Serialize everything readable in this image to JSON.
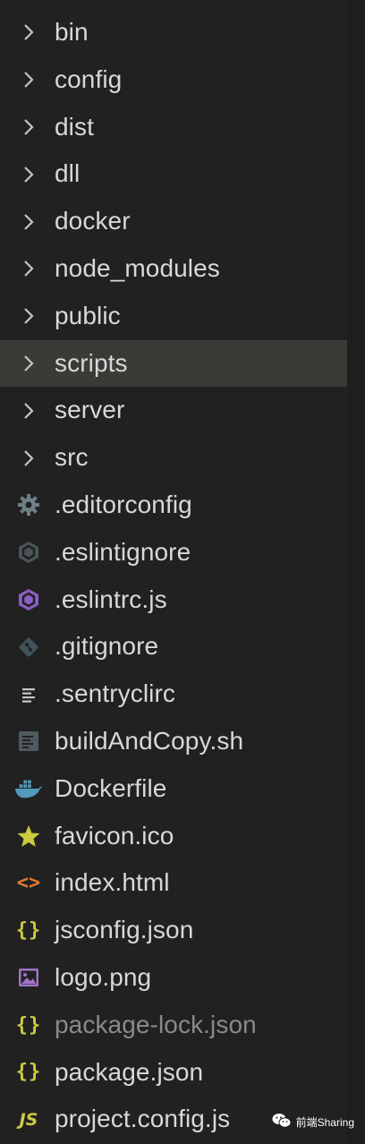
{
  "explorer": {
    "items": [
      {
        "label": "bin",
        "type": "folder",
        "icon": "chevron-right-icon"
      },
      {
        "label": "config",
        "type": "folder",
        "icon": "chevron-right-icon"
      },
      {
        "label": "dist",
        "type": "folder",
        "icon": "chevron-right-icon"
      },
      {
        "label": "dll",
        "type": "folder",
        "icon": "chevron-right-icon"
      },
      {
        "label": "docker",
        "type": "folder",
        "icon": "chevron-right-icon"
      },
      {
        "label": "node_modules",
        "type": "folder",
        "icon": "chevron-right-icon"
      },
      {
        "label": "public",
        "type": "folder",
        "icon": "chevron-right-icon"
      },
      {
        "label": "scripts",
        "type": "folder",
        "icon": "chevron-right-icon",
        "selected": true
      },
      {
        "label": "server",
        "type": "folder",
        "icon": "chevron-right-icon"
      },
      {
        "label": "src",
        "type": "folder",
        "icon": "chevron-right-icon"
      },
      {
        "label": ".editorconfig",
        "type": "file",
        "icon": "gear-icon"
      },
      {
        "label": ".eslintignore",
        "type": "file",
        "icon": "eslint-ignore-icon"
      },
      {
        "label": ".eslintrc.js",
        "type": "file",
        "icon": "eslint-icon"
      },
      {
        "label": ".gitignore",
        "type": "file",
        "icon": "git-icon"
      },
      {
        "label": ".sentryclirc",
        "type": "file",
        "icon": "lines-icon"
      },
      {
        "label": "buildAndCopy.sh",
        "type": "file",
        "icon": "shell-script-icon"
      },
      {
        "label": "Dockerfile",
        "type": "file",
        "icon": "docker-whale-icon"
      },
      {
        "label": "favicon.ico",
        "type": "file",
        "icon": "star-icon"
      },
      {
        "label": "index.html",
        "type": "file",
        "icon": "html-brackets-icon",
        "glyph": "<>"
      },
      {
        "label": "jsconfig.json",
        "type": "file",
        "icon": "json-braces-icon",
        "glyph": "{}"
      },
      {
        "label": "logo.png",
        "type": "file",
        "icon": "image-icon"
      },
      {
        "label": "package-lock.json",
        "type": "file",
        "icon": "json-braces-icon",
        "glyph": "{}",
        "dimmed": true
      },
      {
        "label": "package.json",
        "type": "file",
        "icon": "json-braces-icon",
        "glyph": "{}"
      },
      {
        "label": "project.config.js",
        "type": "file",
        "icon": "javascript-icon",
        "glyph": "JS"
      }
    ]
  },
  "watermark": {
    "text": "前端Sharing",
    "icon": "wechat-icon"
  },
  "colors": {
    "background": "#212121",
    "selected_row": "#3a3a37",
    "text": "#d8d8d8",
    "dimmed_text": "#8a8a8a",
    "json_yellow": "#cbcb41",
    "eslint_purple": "#8b5fc4",
    "html_orange": "#e37933",
    "docker_blue": "#519aba",
    "icon_grey": "#6d8086"
  }
}
